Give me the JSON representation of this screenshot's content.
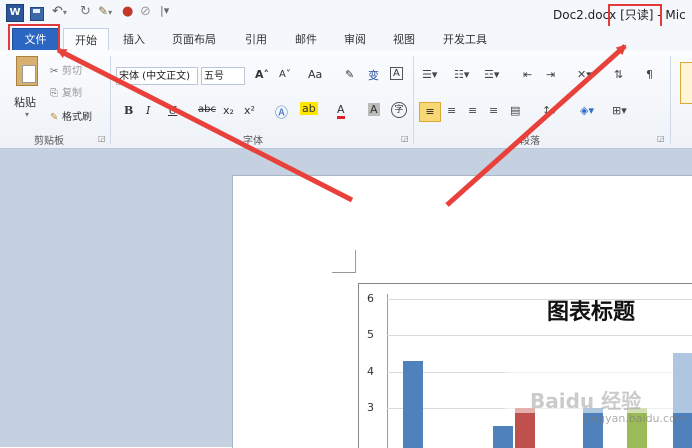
{
  "title_bar": {
    "app_icon": "W",
    "doc_title": "Doc2.docx [只读] - Mic",
    "quick_access": [
      "save-icon",
      "undo-icon",
      "redo-icon",
      "format-painter-icon",
      "color-icon",
      "clear-icon"
    ]
  },
  "tabs": [
    "文件",
    "开始",
    "插入",
    "页面布局",
    "引用",
    "邮件",
    "审阅",
    "视图",
    "开发工具"
  ],
  "clipboard": {
    "paste": "粘贴",
    "cut": "剪切",
    "copy": "复制",
    "format_painter": "格式刷",
    "group_label": "剪贴板"
  },
  "font": {
    "font_name": "宋体 (中文正文)",
    "font_size": "五号",
    "bold": "B",
    "italic": "I",
    "underline": "U",
    "strike": "abc",
    "subscript": "x₂",
    "superscript": "x²",
    "grow": "A˄",
    "shrink": "A˅",
    "case": "Aa",
    "pinyin": "变",
    "border_char": "A",
    "font_color": "A",
    "shading": "A",
    "enclose": "字",
    "group_label": "字体"
  },
  "paragraph": {
    "group_label": "段落"
  },
  "chart_data": {
    "type": "bar",
    "title": "图表标题",
    "ylim": [
      0,
      6
    ],
    "yticks": [
      "6",
      "5",
      "4",
      "3"
    ],
    "series": [
      {
        "name": "",
        "color": "#4f81bd",
        "values": [
          4.3,
          2.5,
          3.0,
          4.5
        ]
      },
      {
        "name": "",
        "color": "#c0504d",
        "values": [
          null,
          3.0,
          null,
          null
        ]
      },
      {
        "name": "",
        "color": "#9bbb59",
        "values": [
          null,
          null,
          3.0,
          null
        ]
      }
    ]
  },
  "watermark": {
    "text": "Baidu 经验",
    "url": "jingyan.baidu.com"
  },
  "colors": {
    "file_tab": "#2b66c3",
    "ribbon": "#eef2f8",
    "workspace": "#c5d1e0",
    "annotation": "#e03a3a"
  }
}
